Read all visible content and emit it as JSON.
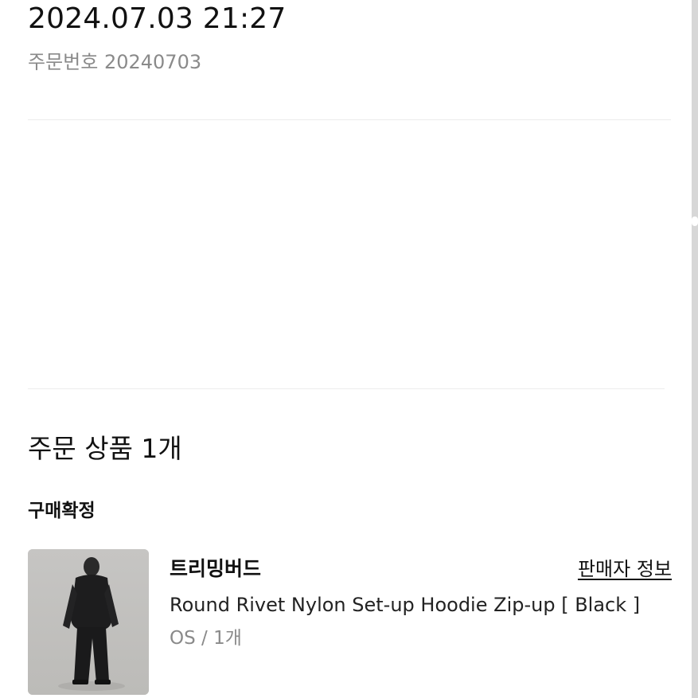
{
  "order": {
    "datetime": "2024.07.03 21:27",
    "number_label": "주문번호 20240703"
  },
  "products_section": {
    "title": "주문 상품 1개",
    "status": "구매확정",
    "items": [
      {
        "brand": "트리밍버드",
        "seller_link": "판매자 정보",
        "name": "Round Rivet Nylon Set-up Hoodie Zip-up [ Black ]",
        "option": "OS / 1개"
      }
    ]
  }
}
